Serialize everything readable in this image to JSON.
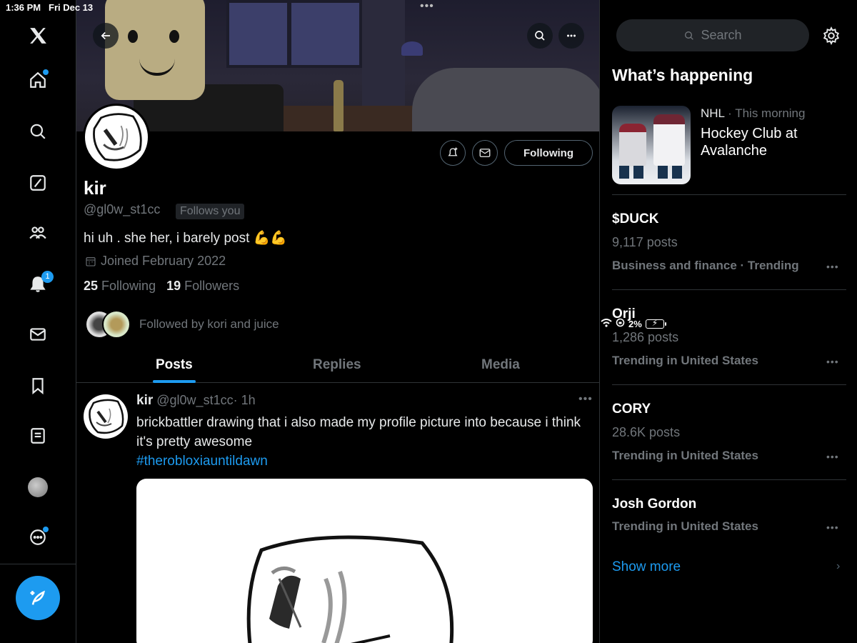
{
  "status_bar": {
    "time": "1:36 PM",
    "date": "Fri Dec 13",
    "battery": "2%"
  },
  "nav": {
    "items": [
      "x-logo-icon",
      "home-icon",
      "explore-icon",
      "grok-icon",
      "communities-icon",
      "notifications-icon",
      "messages-icon",
      "bookmarks-icon",
      "lists-icon",
      "profile-icon",
      "more-icon"
    ],
    "notifications_badge": "1"
  },
  "profile": {
    "display_name": "kir",
    "handle": "@gl0w_st1cc",
    "follows_you": "Follows you",
    "bio": "hi uh . she her, i barely post 💪💪",
    "joined": "Joined February 2022",
    "following_count": "25",
    "following_label": "Following",
    "followers_count": "19",
    "followers_label": "Followers",
    "followed_by": "Followed by kori and juice",
    "following_button": "Following"
  },
  "tabs": [
    {
      "label": "Posts",
      "active": true
    },
    {
      "label": "Replies",
      "active": false
    },
    {
      "label": "Media",
      "active": false
    }
  ],
  "tweet": {
    "name": "kir",
    "handle": "@gl0w_st1cc",
    "time": "· 1h",
    "text": "brickbattler drawing that i also made my profile picture into because i think it's pretty awesome",
    "hashtag": "#therobloxiauntildawn"
  },
  "sidebar": {
    "search_placeholder": "Search",
    "title": "What’s happening",
    "featured": {
      "category": "NHL",
      "time": "· This morning",
      "headline": "Hockey Club at Avalanche"
    },
    "trends": [
      {
        "name": "$DUCK",
        "posts": "9,117 posts",
        "context": "Business and finance · Trending"
      },
      {
        "name": "Orji",
        "posts": "1,286 posts",
        "context": "Trending in United States"
      },
      {
        "name": "CORY",
        "posts": "28.6K posts",
        "context": "Trending in United States"
      },
      {
        "name": "Josh Gordon",
        "posts": "",
        "context": "Trending in United States"
      }
    ],
    "show_more": "Show more"
  },
  "colors": {
    "accent": "#1d9bf0",
    "background": "#000000",
    "muted": "#71767b",
    "border": "#2f3336"
  }
}
